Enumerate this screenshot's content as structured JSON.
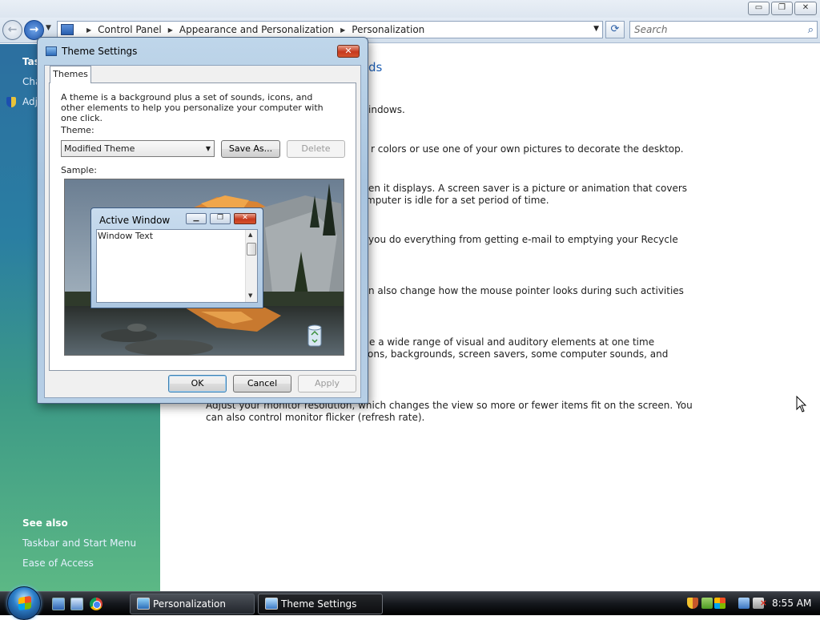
{
  "explorer": {
    "address": {
      "crumbs": [
        "Control Panel",
        "Appearance and Personalization",
        "Personalization"
      ]
    },
    "search": {
      "placeholder": "Search"
    },
    "caption_buttons": {
      "minimize": "▭",
      "maximize": "❐",
      "close": "✕"
    }
  },
  "taskpane": {
    "tasks_heading": "Tas",
    "tasks": [
      "Cha",
      "Adj"
    ],
    "see_also_heading": "See also",
    "see_also": [
      "Taskbar and Start Menu",
      "Ease of Access"
    ]
  },
  "main": {
    "heading_fragment": "ds",
    "lines": [
      "indows.",
      "r colors or use one of your own pictures to decorate the desktop.",
      "en it displays. A screen saver is a picture or animation that covers",
      "mputer is idle for a set period of time.",
      "you do everything from getting e-mail to emptying your Recycle",
      "n also change how the mouse pointer looks during such activities",
      "e a wide range of visual and auditory elements at one time",
      "ons, backgrounds, screen savers, some computer sounds, and",
      "Adjust your monitor resolution, which changes the view so more or fewer items fit on the screen. You",
      "can also control monitor flicker (refresh rate)."
    ]
  },
  "dialog": {
    "title": "Theme Settings",
    "tab": "Themes",
    "description": "A theme is a background plus a set of sounds, icons, and other elements to help you personalize your computer with one click.",
    "theme_label": "Theme:",
    "theme_value": "Modified Theme",
    "save_as": "Save As...",
    "delete": "Delete",
    "sample_label": "Sample:",
    "preview": {
      "window_title": "Active Window",
      "window_text": "Window Text"
    },
    "ok": "OK",
    "cancel": "Cancel",
    "apply": "Apply"
  },
  "taskbar": {
    "buttons": [
      "Personalization",
      "Theme Settings"
    ],
    "clock": "8:55 AM"
  },
  "colors": {
    "accent": "#1e5fb4",
    "taskbar": "#15181d",
    "pane_top": "#2c6fa0",
    "pane_bottom": "#5cb885"
  },
  "icons": {
    "start": "windows-flag-icon",
    "search": "magnifier-icon",
    "refresh": "refresh-icon",
    "recycle_bin": "recycle-bin-icon"
  }
}
